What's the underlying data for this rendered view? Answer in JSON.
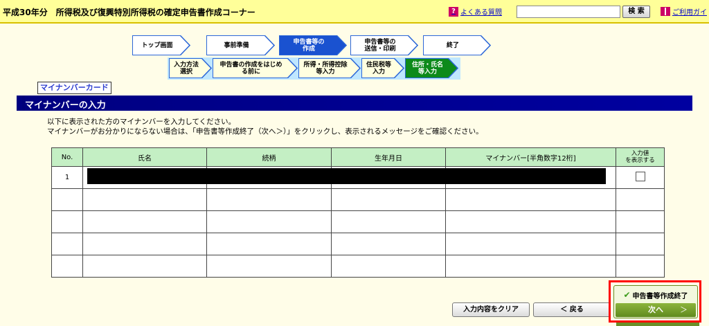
{
  "header": {
    "title": "平成30年分　所得税及び復興特別所得税の確定申告書作成コーナー",
    "faq_label": "よくある質問",
    "faq_icon": "?",
    "search_placeholder": "",
    "search_button": "検 索",
    "guide_label": "ご利用ガイ"
  },
  "steps": [
    {
      "label": "トップ画面",
      "active": false
    },
    {
      "label": "事前準備",
      "active": false
    },
    {
      "label": "申告書等の\n作成",
      "active": true
    },
    {
      "label": "申告書等の\n送信・印刷",
      "active": false
    },
    {
      "label": "終了",
      "active": false
    }
  ],
  "substeps": [
    {
      "label": "入力方法\n選択",
      "current": false
    },
    {
      "label": "申告書の作成をはじめ\nる前に",
      "current": false
    },
    {
      "label": "所得・所得控除\n等入力",
      "current": false
    },
    {
      "label": "住民税等\n入力",
      "current": false
    },
    {
      "label": "住所・氏名\n等入力",
      "current": true
    }
  ],
  "section": {
    "tab": "マイナンバーカード",
    "title": "マイナンバーの入力",
    "desc1": "以下に表示された方のマイナンバーを入力してください。",
    "desc2": "マイナンバーがお分かりにならない場合は、「申告書等作成終了（次へ＞）」をクリックし、表示されるメッセージをご確認ください。"
  },
  "table": {
    "columns": [
      "No.",
      "氏名",
      "続柄",
      "生年月日",
      "マイナンバー[半角数字12桁]",
      "入力値\nを表示する"
    ],
    "rows": [
      {
        "no": "1",
        "show_checkbox": true
      },
      {
        "no": "",
        "show_checkbox": false
      },
      {
        "no": "",
        "show_checkbox": false
      },
      {
        "no": "",
        "show_checkbox": false
      },
      {
        "no": "",
        "show_checkbox": false
      }
    ]
  },
  "buttons": {
    "clear": "入力内容をクリア",
    "back": "＜ 戻る",
    "finish": "申告書等作成終了",
    "next": "次へ",
    "next_arrow": "＞"
  },
  "colors": {
    "header_bg": "#ffff99",
    "section_bar": "#000080",
    "table_header": "#c4efc4",
    "active_step": "#1a52d0",
    "current_substep": "#0d8a1a",
    "highlight": "#ff0000"
  }
}
